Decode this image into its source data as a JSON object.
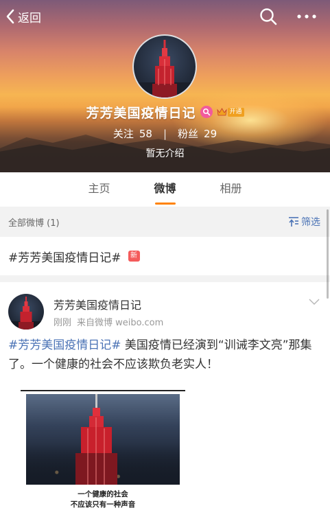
{
  "nav": {
    "back_label": "返回",
    "back_icon": "chevron-left-icon",
    "search_icon": "search-icon",
    "more_icon": "more-dots-icon"
  },
  "profile": {
    "name": "芳芳美国疫情日记",
    "vip_label": "开通",
    "following_label": "关注",
    "following_count": "58",
    "followers_label": "粉丝",
    "followers_count": "29",
    "intro": "暂无介绍"
  },
  "tabs": [
    {
      "label": "主页",
      "active": false
    },
    {
      "label": "微博",
      "active": true
    },
    {
      "label": "相册",
      "active": false
    }
  ],
  "filter": {
    "count_label": "全部微博 (1)",
    "filter_label": "筛选"
  },
  "topic": {
    "text": "#芳芳美国疫情日记#",
    "new_badge": "新"
  },
  "post": {
    "author": "芳芳美国疫情日记",
    "time": "刚刚",
    "source": "来自微博 weibo.com",
    "hashtag": "#芳芳美国疫情日记#",
    "text": " 美国疫情已经演到“训诫李文亮”那集了。一个健康的社会不应该欺负老实人！",
    "image_caption_line1": "一个健康的社会",
    "image_caption_line2": "不应该只有一种声音"
  },
  "colors": {
    "accent_orange": "#ff8200",
    "link_blue": "#4a72b5",
    "new_badge_red": "#f45b5b"
  }
}
